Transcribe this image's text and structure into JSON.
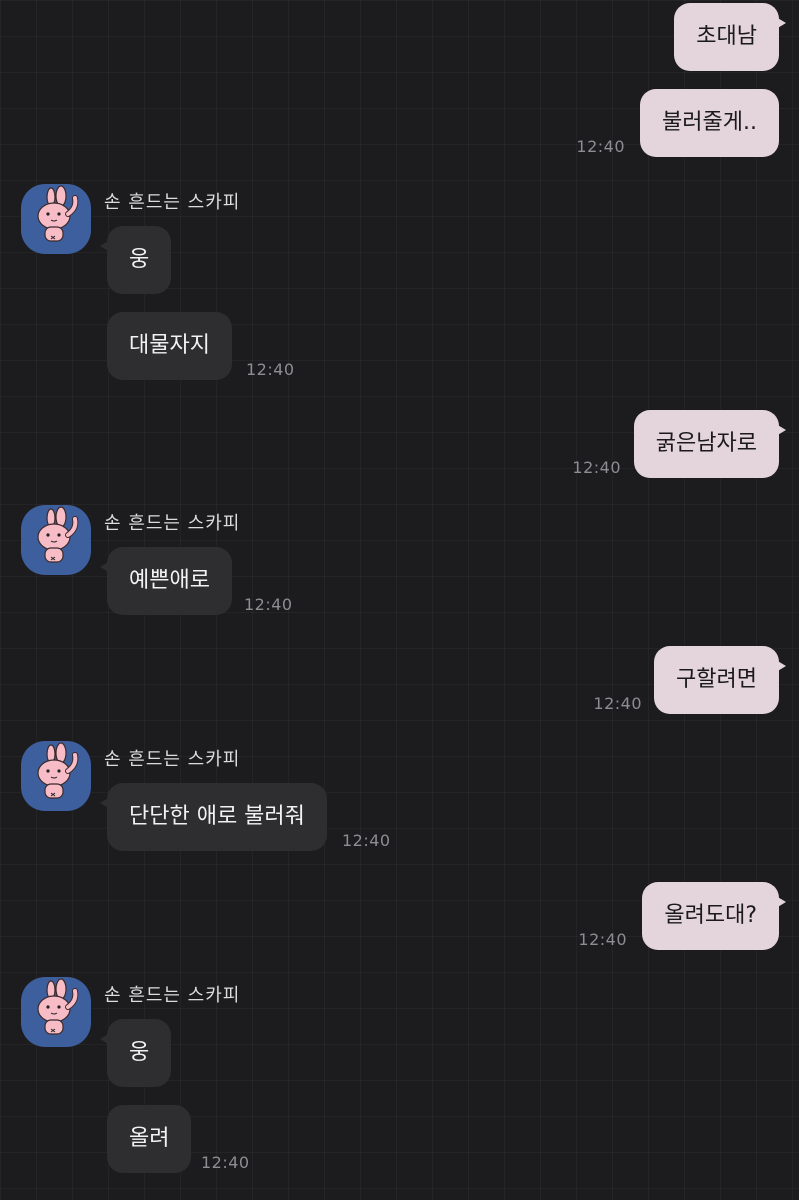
{
  "chat": {
    "contact_name": "손 흔드는 스카피",
    "messages": [
      {
        "from": "me",
        "text": "초대남"
      },
      {
        "from": "me",
        "text": "불러줄게..",
        "time": "12:40"
      },
      {
        "from": "other",
        "text": "웅"
      },
      {
        "from": "other",
        "text": "대물자지",
        "time": "12:40"
      },
      {
        "from": "me",
        "text": "굵은남자로",
        "time": "12:40"
      },
      {
        "from": "other",
        "text": "예쁜애로",
        "time": "12:40"
      },
      {
        "from": "me",
        "text": "구할려면",
        "time": "12:40"
      },
      {
        "from": "other",
        "text": "단단한 애로 불러줘",
        "time": "12:40"
      },
      {
        "from": "me",
        "text": "올려도대?",
        "time": "12:40"
      },
      {
        "from": "other",
        "text": "웅"
      },
      {
        "from": "other",
        "text": "올려",
        "time": "12:40"
      }
    ]
  },
  "colors": {
    "background": "#1c1c1e",
    "my_bubble": "#e4d4db",
    "other_bubble": "#2e2e31",
    "avatar_bg": "#3d5f9e",
    "timestamp": "#8d8d92"
  },
  "icons": {
    "avatar": "pink-rabbit-waving-icon"
  }
}
